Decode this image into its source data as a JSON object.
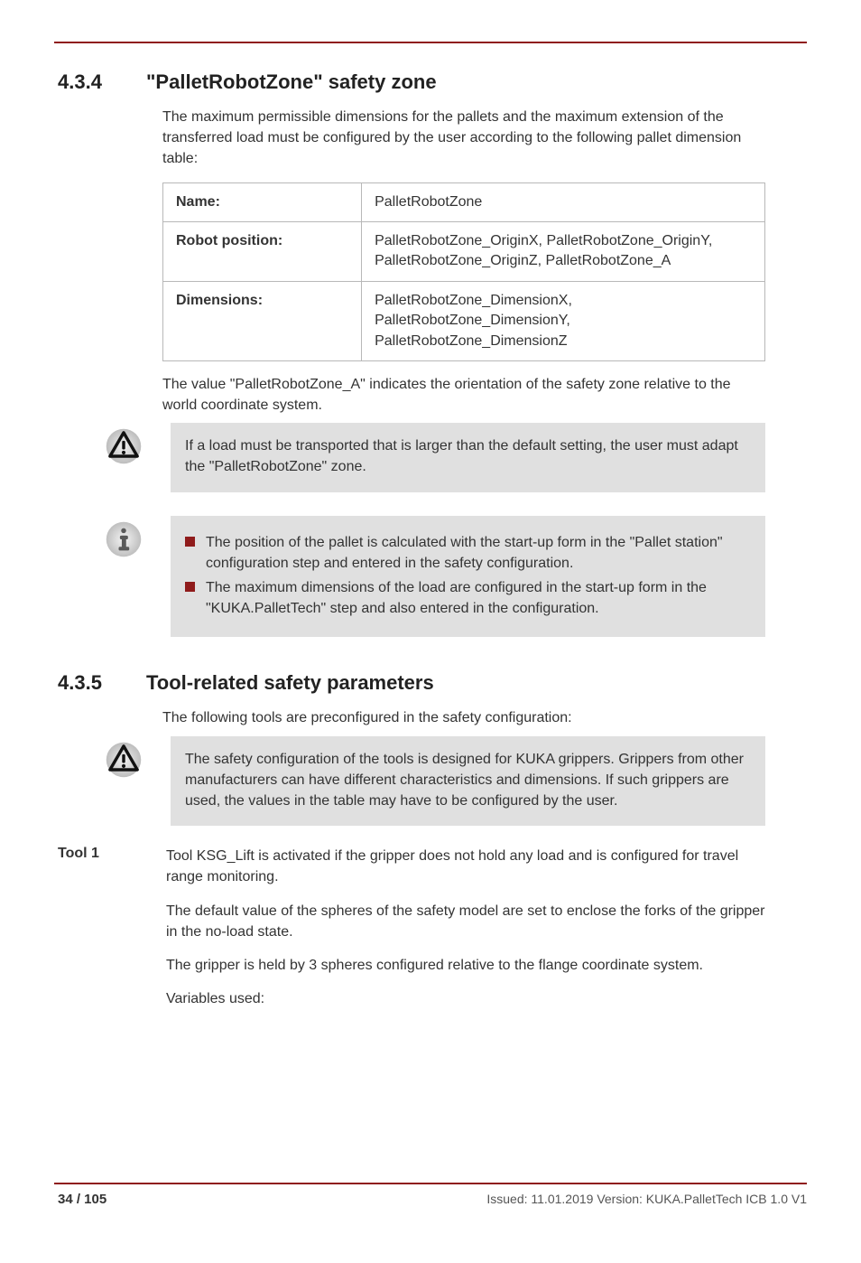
{
  "header": {},
  "sections": {
    "s1": {
      "num": "4.3.4",
      "title": "\"PalletRobotZone\" safety zone",
      "intro": "The maximum permissible dimensions for the pallets and the maximum extension of the transferred load must be configured by the user according to the following pallet dimension table:",
      "table": {
        "r0": {
          "k": "Name:",
          "v": "PalletRobotZone"
        },
        "r1": {
          "k": "Robot position:",
          "v": "PalletRobotZone_OriginX, PalletRobotZone_OriginY, PalletRobotZone_OriginZ, PalletRobotZone_A"
        },
        "r2": {
          "k": "Dimensions:",
          "v": "PalletRobotZone_DimensionX, PalletRobotZone_DimensionY, PalletRobotZone_DimensionZ"
        }
      },
      "tnote": "The value \"PalletRobotZone_A\" indicates the orientation of the safety zone relative to the world coordinate system.",
      "warning": "If a load must be transported that is larger than the default setting, the user must adapt the \"PalletRobotZone\" zone.",
      "info": {
        "i0": "The position of the pallet is calculated with the start-up form in the \"Pallet station\" configuration step and entered in the safety configuration.",
        "i1": "The maximum dimensions of the load are configured in the start-up form in the \"KUKA.PalletTech\" step and also entered in the configuration."
      }
    },
    "s2": {
      "num": "4.3.5",
      "title": "Tool-related safety parameters",
      "intro": "The following tools are preconfigured in the safety configuration:",
      "warning": "The safety configuration of the tools is designed for KUKA grippers. Grippers from other manufacturers can have different characteristics and dimensions. If such grippers are used, the values in the table may have to be configured by the user.",
      "t1": {
        "title": "Tool 1",
        "p0": "Tool KSG_Lift is activated if the gripper does not hold any load and is configured for travel range monitoring.",
        "p1": "The default value of the spheres of the safety model are set to enclose the forks of the gripper in the no-load state.",
        "p2": "The gripper is held by 3 spheres configured relative to the flange coordinate system.",
        "p3": "Variables used:"
      }
    }
  },
  "footer": {
    "page": "34 / 105",
    "doc": "Issued: 11.01.2019 Version: KUKA.PalletTech ICB 1.0 V1"
  }
}
